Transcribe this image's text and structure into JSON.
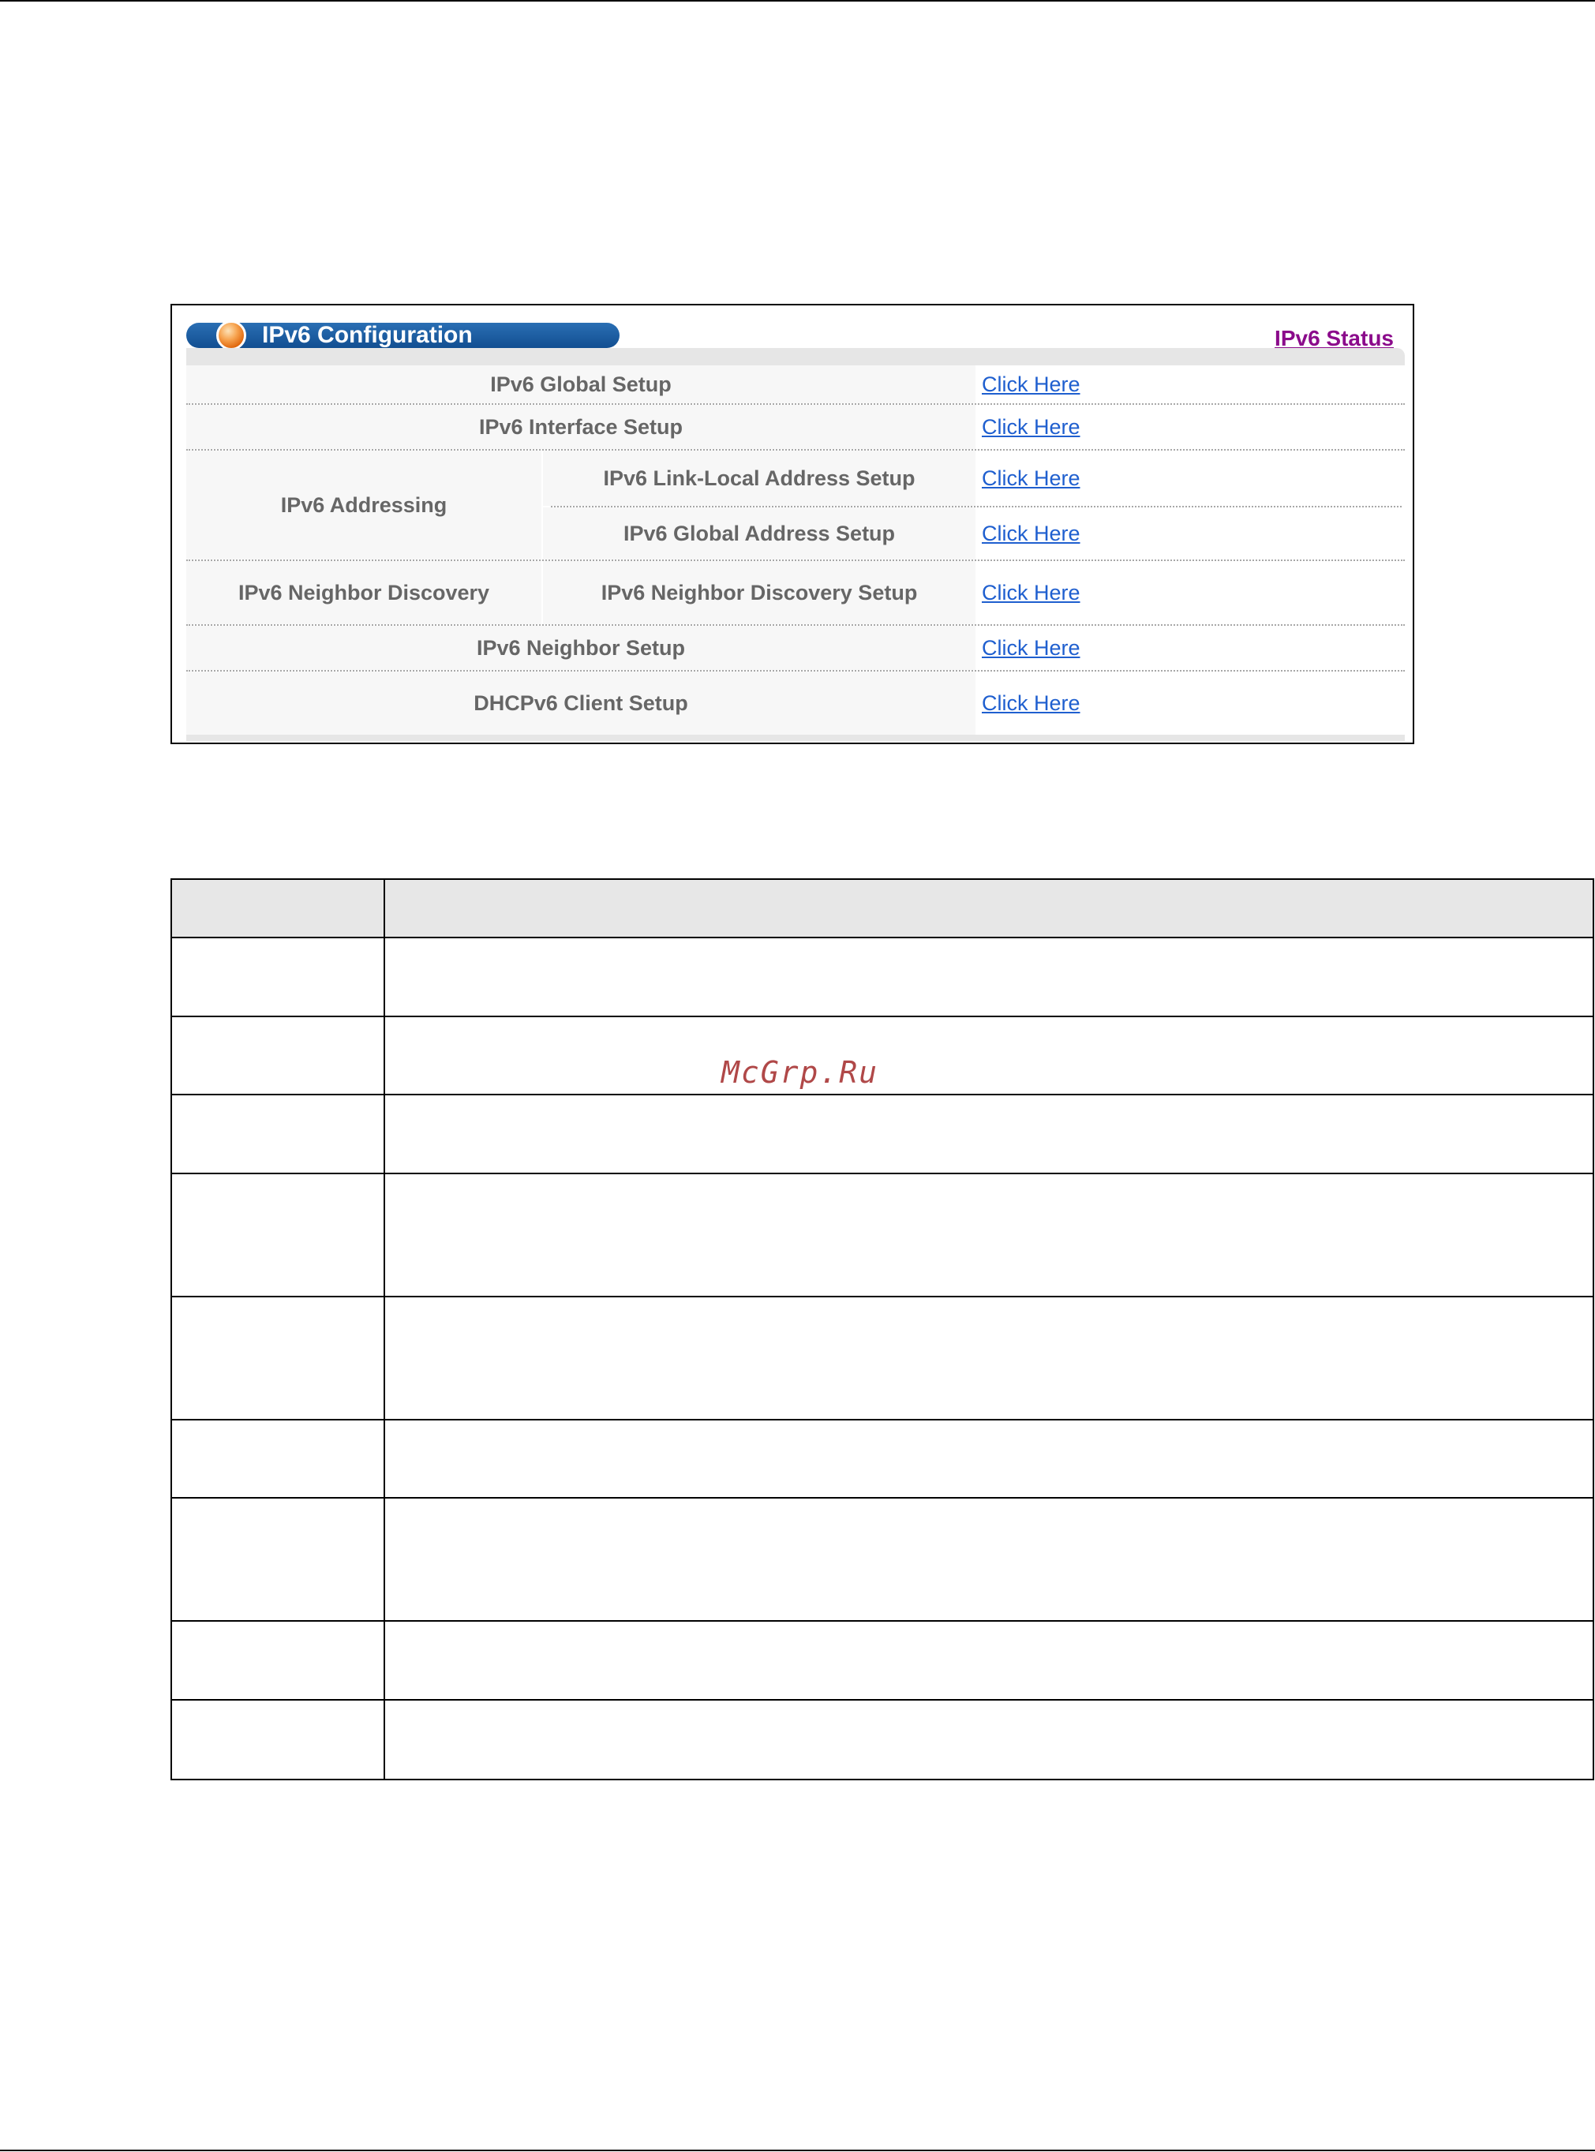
{
  "panel": {
    "title": "IPv6 Configuration",
    "status_link": "IPv6 Status"
  },
  "rows": {
    "global_setup": {
      "label": "IPv6 Global Setup",
      "link": "Click Here"
    },
    "interface_setup": {
      "label": "IPv6 Interface Setup",
      "link": "Click Here"
    },
    "addressing": {
      "group": "IPv6 Addressing",
      "link_local": {
        "label": "IPv6 Link-Local Address Setup",
        "link": "Click Here"
      },
      "global_address": {
        "label": "IPv6 Global Address Setup",
        "link": "Click Here"
      }
    },
    "neighbor_discovery": {
      "group": "IPv6 Neighbor Discovery",
      "setup": {
        "label": "IPv6 Neighbor Discovery Setup",
        "link": "Click Here"
      }
    },
    "neighbor_setup": {
      "label": "IPv6 Neighbor Setup",
      "link": "Click Here"
    },
    "dhcpv6_client": {
      "label": "DHCPv6 Client Setup",
      "link": "Click Here"
    }
  },
  "colors": {
    "title_bar": "#1a5fa6",
    "label_text": "#666666",
    "link": "#1f5fcf",
    "status_link": "#8b0b8b"
  },
  "icons": [
    "orange-orb-icon"
  ],
  "watermark": "McGrp.Ru"
}
